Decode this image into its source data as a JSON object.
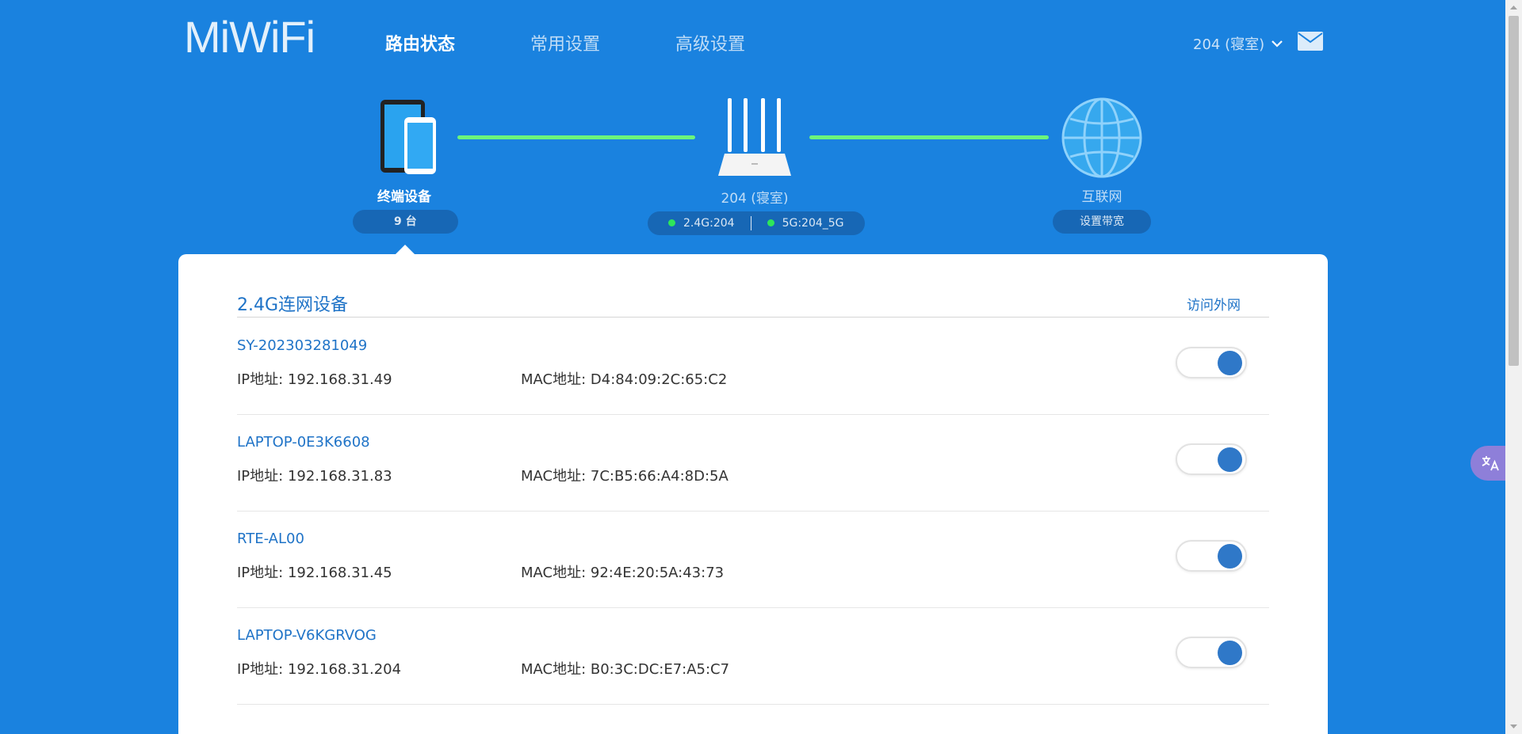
{
  "header": {
    "logo": "MiWiFi",
    "nav": [
      {
        "label": "路由状态",
        "active": true
      },
      {
        "label": "常用设置",
        "active": false
      },
      {
        "label": "高级设置",
        "active": false
      }
    ],
    "user": "204 (寝室)"
  },
  "topology": {
    "devices": {
      "label": "终端设备",
      "count": "9 台"
    },
    "router": {
      "label": "204 (寝室)",
      "wifi_24": "2.4G:204",
      "wifi_5": "5G:204_5G"
    },
    "internet": {
      "label": "互联网",
      "action": "设置带宽"
    }
  },
  "panel": {
    "title": "2.4G连网设备",
    "column": "访问外网",
    "devices": [
      {
        "name": "SY-202303281049",
        "ip": "IP地址: 192.168.31.49",
        "mac": "MAC地址: D4:84:09:2C:65:C2",
        "internet_on": true
      },
      {
        "name": "LAPTOP-0E3K6608",
        "ip": "IP地址: 192.168.31.83",
        "mac": "MAC地址: 7C:B5:66:A4:8D:5A",
        "internet_on": true
      },
      {
        "name": "RTE-AL00",
        "ip": "IP地址: 192.168.31.45",
        "mac": "MAC地址: 92:4E:20:5A:43:73",
        "internet_on": true
      },
      {
        "name": "LAPTOP-V6KGRVOG",
        "ip": "IP地址: 192.168.31.204",
        "mac": "MAC地址: B0:3C:DC:E7:A5:C7",
        "internet_on": true
      }
    ]
  },
  "colors": {
    "background": "#1a82df",
    "accent": "#1f73c7",
    "link_line": "#6cf57a",
    "toggle_on": "#2f78c8"
  }
}
